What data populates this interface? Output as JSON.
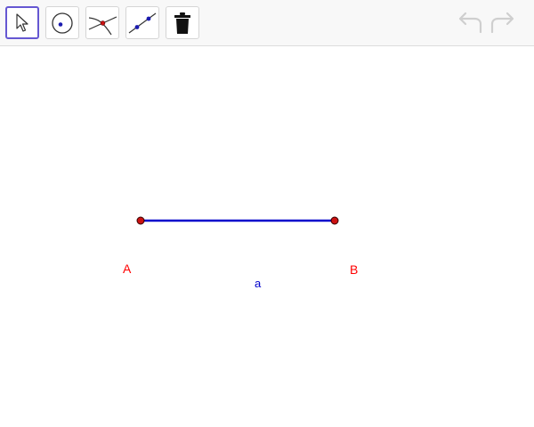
{
  "toolbar": {
    "tools": [
      {
        "icon": "move-arrow-icon",
        "active": true
      },
      {
        "icon": "circle-point-icon",
        "active": false
      },
      {
        "icon": "intersect-icon",
        "active": false
      },
      {
        "icon": "line-through-points-icon",
        "active": false
      },
      {
        "icon": "trash-icon",
        "active": false
      }
    ],
    "history": [
      {
        "icon": "undo-icon",
        "enabled": false
      },
      {
        "icon": "redo-icon",
        "enabled": false
      }
    ]
  },
  "construction": {
    "point_a": {
      "label": "A",
      "color": "#ff0000"
    },
    "point_b": {
      "label": "B",
      "color": "#ff0000"
    },
    "segment": {
      "label": "a",
      "color": "#0000cc"
    }
  },
  "colors": {
    "active_tool_border": "#6557d2",
    "point_fill": "#cc1111",
    "segment": "#0000cc",
    "label_point": "#ff0000",
    "label_segment": "#0000cc",
    "history_disabled": "#cfcfcf"
  }
}
